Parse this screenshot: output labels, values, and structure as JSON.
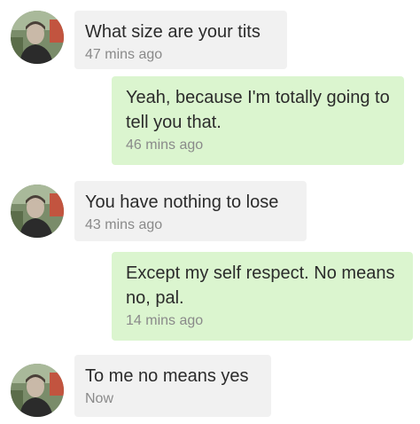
{
  "colors": {
    "incoming_bubble": "#f1f1f1",
    "outgoing_bubble": "#dbf5cf",
    "message_text": "#2b2b2b",
    "timestamp_text": "#8a8a8a"
  },
  "messages": [
    {
      "direction": "incoming",
      "text": "What size are your tits",
      "time": "47 mins ago"
    },
    {
      "direction": "outgoing",
      "text": "Yeah, because I'm totally going to tell you that.",
      "time": "46 mins ago"
    },
    {
      "direction": "incoming",
      "text": "You have nothing to lose",
      "time": "43 mins ago"
    },
    {
      "direction": "outgoing",
      "text": "Except my self respect. No means no, pal.",
      "time": "14 mins ago"
    },
    {
      "direction": "incoming",
      "text": "To me no means yes",
      "time": "Now"
    }
  ]
}
